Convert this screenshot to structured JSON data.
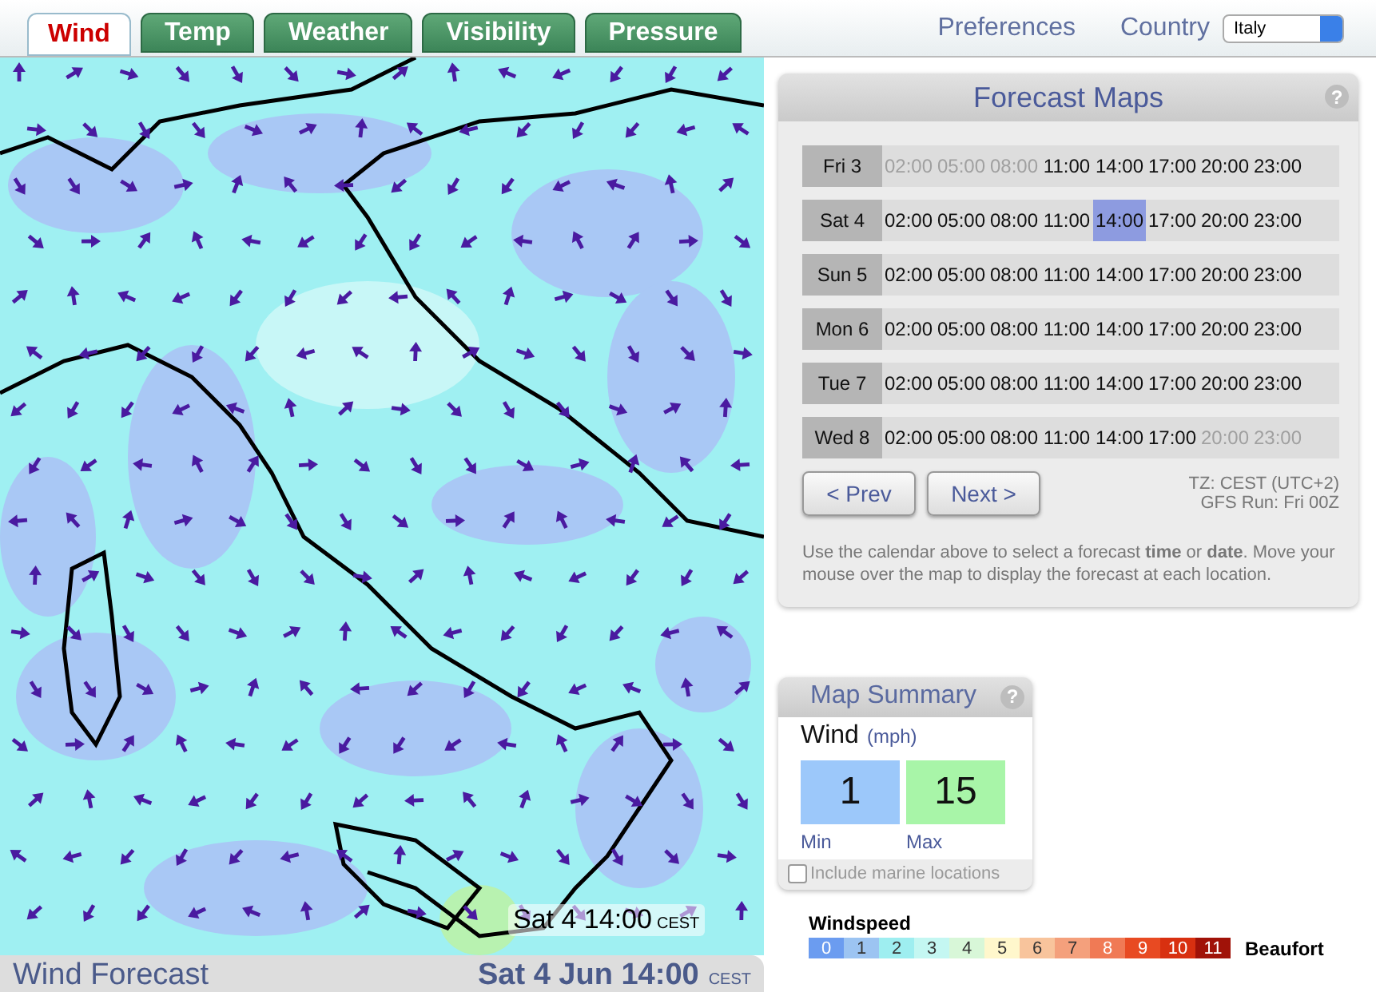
{
  "tabs": [
    {
      "label": "Wind",
      "selected": true
    },
    {
      "label": "Temp",
      "selected": false
    },
    {
      "label": "Weather",
      "selected": false
    },
    {
      "label": "Visibility",
      "selected": false
    },
    {
      "label": "Pressure",
      "selected": false
    }
  ],
  "header": {
    "preferences": "Preferences",
    "country_label": "Country",
    "country_value": "Italy"
  },
  "map": {
    "overlay_time": "Sat 4 14:00",
    "overlay_zone": "CEST"
  },
  "footer": {
    "title": "Wind Forecast",
    "date": "Sat 4 Jun 14:00",
    "zone": "CEST"
  },
  "forecast_maps": {
    "title": "Forecast Maps",
    "help": "?",
    "days": [
      {
        "label": "Fri 3",
        "slots": [
          {
            "time": "02:00",
            "disabled": true,
            "selected": false
          },
          {
            "time": "05:00",
            "disabled": true,
            "selected": false
          },
          {
            "time": "08:00",
            "disabled": true,
            "selected": false
          },
          {
            "time": "11:00",
            "disabled": false,
            "selected": false
          },
          {
            "time": "14:00",
            "disabled": false,
            "selected": false
          },
          {
            "time": "17:00",
            "disabled": false,
            "selected": false
          },
          {
            "time": "20:00",
            "disabled": false,
            "selected": false
          },
          {
            "time": "23:00",
            "disabled": false,
            "selected": false
          }
        ]
      },
      {
        "label": "Sat 4",
        "slots": [
          {
            "time": "02:00",
            "disabled": false,
            "selected": false
          },
          {
            "time": "05:00",
            "disabled": false,
            "selected": false
          },
          {
            "time": "08:00",
            "disabled": false,
            "selected": false
          },
          {
            "time": "11:00",
            "disabled": false,
            "selected": false
          },
          {
            "time": "14:00",
            "disabled": false,
            "selected": true
          },
          {
            "time": "17:00",
            "disabled": false,
            "selected": false
          },
          {
            "time": "20:00",
            "disabled": false,
            "selected": false
          },
          {
            "time": "23:00",
            "disabled": false,
            "selected": false
          }
        ]
      },
      {
        "label": "Sun 5",
        "slots": [
          {
            "time": "02:00",
            "disabled": false,
            "selected": false
          },
          {
            "time": "05:00",
            "disabled": false,
            "selected": false
          },
          {
            "time": "08:00",
            "disabled": false,
            "selected": false
          },
          {
            "time": "11:00",
            "disabled": false,
            "selected": false
          },
          {
            "time": "14:00",
            "disabled": false,
            "selected": false
          },
          {
            "time": "17:00",
            "disabled": false,
            "selected": false
          },
          {
            "time": "20:00",
            "disabled": false,
            "selected": false
          },
          {
            "time": "23:00",
            "disabled": false,
            "selected": false
          }
        ]
      },
      {
        "label": "Mon 6",
        "slots": [
          {
            "time": "02:00",
            "disabled": false,
            "selected": false
          },
          {
            "time": "05:00",
            "disabled": false,
            "selected": false
          },
          {
            "time": "08:00",
            "disabled": false,
            "selected": false
          },
          {
            "time": "11:00",
            "disabled": false,
            "selected": false
          },
          {
            "time": "14:00",
            "disabled": false,
            "selected": false
          },
          {
            "time": "17:00",
            "disabled": false,
            "selected": false
          },
          {
            "time": "20:00",
            "disabled": false,
            "selected": false
          },
          {
            "time": "23:00",
            "disabled": false,
            "selected": false
          }
        ]
      },
      {
        "label": "Tue 7",
        "slots": [
          {
            "time": "02:00",
            "disabled": false,
            "selected": false
          },
          {
            "time": "05:00",
            "disabled": false,
            "selected": false
          },
          {
            "time": "08:00",
            "disabled": false,
            "selected": false
          },
          {
            "time": "11:00",
            "disabled": false,
            "selected": false
          },
          {
            "time": "14:00",
            "disabled": false,
            "selected": false
          },
          {
            "time": "17:00",
            "disabled": false,
            "selected": false
          },
          {
            "time": "20:00",
            "disabled": false,
            "selected": false
          },
          {
            "time": "23:00",
            "disabled": false,
            "selected": false
          }
        ]
      },
      {
        "label": "Wed 8",
        "slots": [
          {
            "time": "02:00",
            "disabled": false,
            "selected": false
          },
          {
            "time": "05:00",
            "disabled": false,
            "selected": false
          },
          {
            "time": "08:00",
            "disabled": false,
            "selected": false
          },
          {
            "time": "11:00",
            "disabled": false,
            "selected": false
          },
          {
            "time": "14:00",
            "disabled": false,
            "selected": false
          },
          {
            "time": "17:00",
            "disabled": false,
            "selected": false
          },
          {
            "time": "20:00",
            "disabled": true,
            "selected": false
          },
          {
            "time": "23:00",
            "disabled": true,
            "selected": false
          }
        ]
      }
    ],
    "prev": "< Prev",
    "next": "Next >",
    "timezone": "TZ: CEST (UTC+2)",
    "gfs_run": "GFS Run: Fri 00Z",
    "help_text": "Use the calendar above to select a forecast **time** or **date**. Move your mouse over the map to display the forecast at each location."
  },
  "map_summary": {
    "title": "Map Summary",
    "help": "?",
    "variable": "Wind",
    "unit": "(mph)",
    "min_value": "1",
    "max_value": "15",
    "min_label": "Min",
    "max_label": "Max",
    "marine_label": "Include marine locations",
    "marine_checked": false
  },
  "legend": {
    "title": "Windspeed",
    "scale_label": "Beaufort",
    "items": [
      {
        "label": "0",
        "color": "#6b9cf0"
      },
      {
        "label": "1",
        "color": "#9cc4f2"
      },
      {
        "label": "2",
        "color": "#9eeef0"
      },
      {
        "label": "3",
        "color": "#c4f7f2"
      },
      {
        "label": "4",
        "color": "#d8f7d8"
      },
      {
        "label": "5",
        "color": "#fff7cc"
      },
      {
        "label": "6",
        "color": "#f8c49c"
      },
      {
        "label": "7",
        "color": "#f4a07c"
      },
      {
        "label": "8",
        "color": "#f07a55"
      },
      {
        "label": "9",
        "color": "#e84a22"
      },
      {
        "label": "10",
        "color": "#d83010"
      },
      {
        "label": "11",
        "color": "#a01208"
      }
    ]
  }
}
